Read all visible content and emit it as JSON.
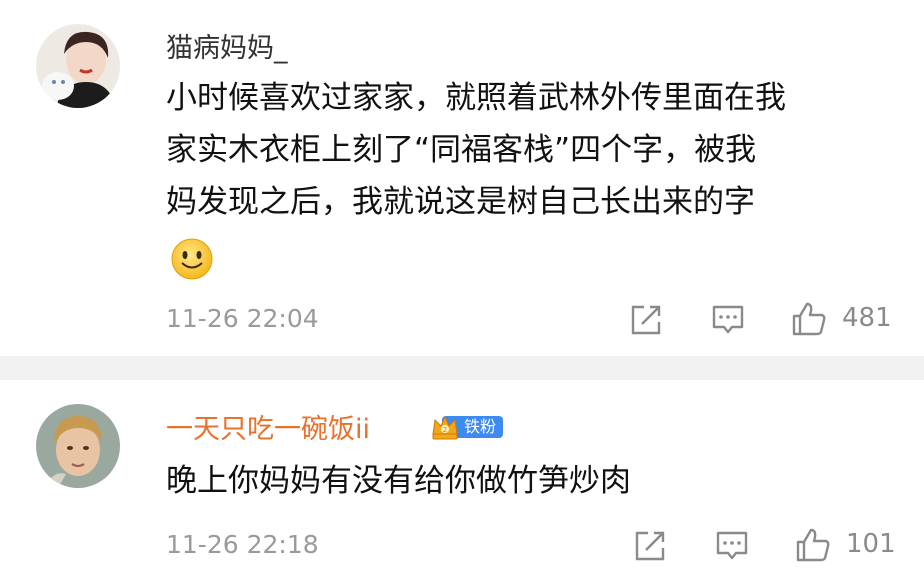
{
  "comments": [
    {
      "username": "猫病妈妈_",
      "text": "小时候喜欢过家家，就照着武林外传里面在我\n家实木衣柜上刻了“同福客栈”四个字，被我\n妈发现之后，我就说这是树自己长出来的字",
      "emoji_icon": "smiley-emoji-icon",
      "time": "11-26 22:04",
      "likes": "481"
    },
    {
      "username": "一天只吃一碗饭ii",
      "username_color": "#e8722c",
      "badge_label": "铁粉",
      "text": "晚上你妈妈有没有给你做竹笋炒肉",
      "time": "11-26 22:18",
      "likes": "101"
    }
  ],
  "icons": [
    "share-icon",
    "comment-icon",
    "like-icon"
  ],
  "colors": {
    "accent_orange": "#e8722c",
    "badge_blue": "#3d8bf0",
    "separator": "#f2f2f2"
  }
}
